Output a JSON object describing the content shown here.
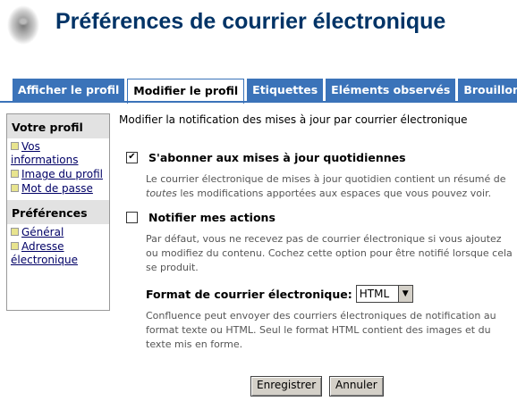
{
  "header": {
    "title": "Préférences de courrier électronique"
  },
  "tabs": [
    {
      "label": "Afficher le profil",
      "active": false
    },
    {
      "label": "Modifier le profil",
      "active": true
    },
    {
      "label": "Etiquettes",
      "active": false
    },
    {
      "label": "Eléments observés",
      "active": false
    },
    {
      "label": "Brouillons",
      "active": false
    }
  ],
  "sidebar": {
    "profile_heading": "Votre profil",
    "profile_items": [
      "Vos informations",
      "Image du profil",
      "Mot de passe"
    ],
    "prefs_heading": "Préférences",
    "prefs_items": [
      "Général",
      "Adresse électronique"
    ]
  },
  "main": {
    "intro": "Modifier la notification des mises à jour par courrier électronique",
    "subscribe": {
      "label": "S'abonner aux mises à jour quotidiennes",
      "checked": true,
      "desc_1": "Le courrier électronique de mises à jour quotidien contient un résumé de",
      "desc_em": "toutes",
      "desc_2": "les modifications apportées aux espaces que vous pouvez voir."
    },
    "notify": {
      "label": "Notifier mes actions",
      "checked": false,
      "desc": "Par défaut, vous ne recevez pas de courrier électronique si vous ajoutez ou modifiez du contenu. Cochez cette option pour être notifié lorsque cela se produit."
    },
    "format": {
      "label": "Format de courrier électronique:",
      "value": "HTML",
      "desc": "Confluence peut envoyer des courriers électroniques de notification au format texte ou HTML. Seul le format HTML contient des images et du texte mis en forme."
    },
    "buttons": {
      "save": "Enregistrer",
      "cancel": "Annuler"
    }
  },
  "icons": {
    "checkmark": "✔",
    "dropdown": "▼"
  },
  "colors": {
    "title": "#003366",
    "tab": "#3b73b9",
    "bullet": "#e8e48e"
  }
}
